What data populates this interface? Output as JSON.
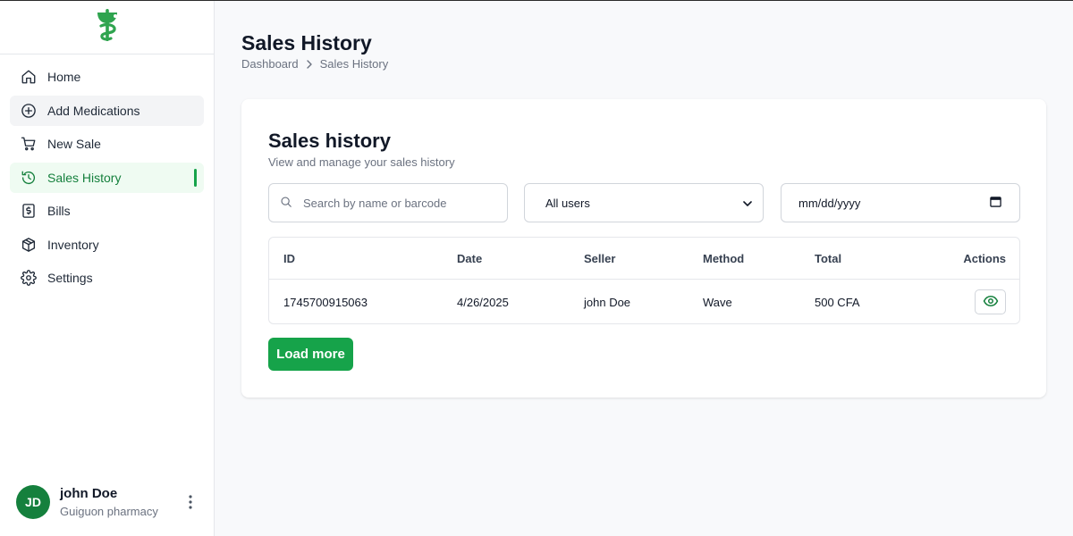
{
  "brand": {
    "logo_icon": "pharmacy-caduceus-icon",
    "accent": "#16a34a"
  },
  "sidebar": {
    "items": [
      {
        "label": "Home",
        "icon": "home-icon"
      },
      {
        "label": "Add Medications",
        "icon": "plus-circle-icon"
      },
      {
        "label": "New Sale",
        "icon": "cart-icon"
      },
      {
        "label": "Sales History",
        "icon": "history-icon",
        "active": true
      },
      {
        "label": "Bills",
        "icon": "bill-icon"
      },
      {
        "label": "Inventory",
        "icon": "box-icon"
      },
      {
        "label": "Settings",
        "icon": "gear-icon"
      }
    ]
  },
  "user": {
    "initials": "JD",
    "name": "john Doe",
    "org": "Guiguon pharmacy"
  },
  "header": {
    "title": "Sales History",
    "breadcrumb": [
      "Dashboard",
      "Sales History"
    ]
  },
  "card": {
    "title": "Sales history",
    "subtitle": "View and manage your sales history",
    "search": {
      "placeholder": "Search by name or barcode",
      "value": ""
    },
    "user_filter": {
      "selected": "All users"
    },
    "date_filter": {
      "value": "mm/dd/yyyy"
    },
    "table": {
      "columns": [
        "ID",
        "Date",
        "Seller",
        "Method",
        "Total",
        "Actions"
      ],
      "rows": [
        {
          "id": "1745700915063",
          "date": "4/26/2025",
          "seller": "john Doe",
          "method": "Wave",
          "total": "500 CFA"
        }
      ]
    },
    "load_more_label": "Load more"
  }
}
